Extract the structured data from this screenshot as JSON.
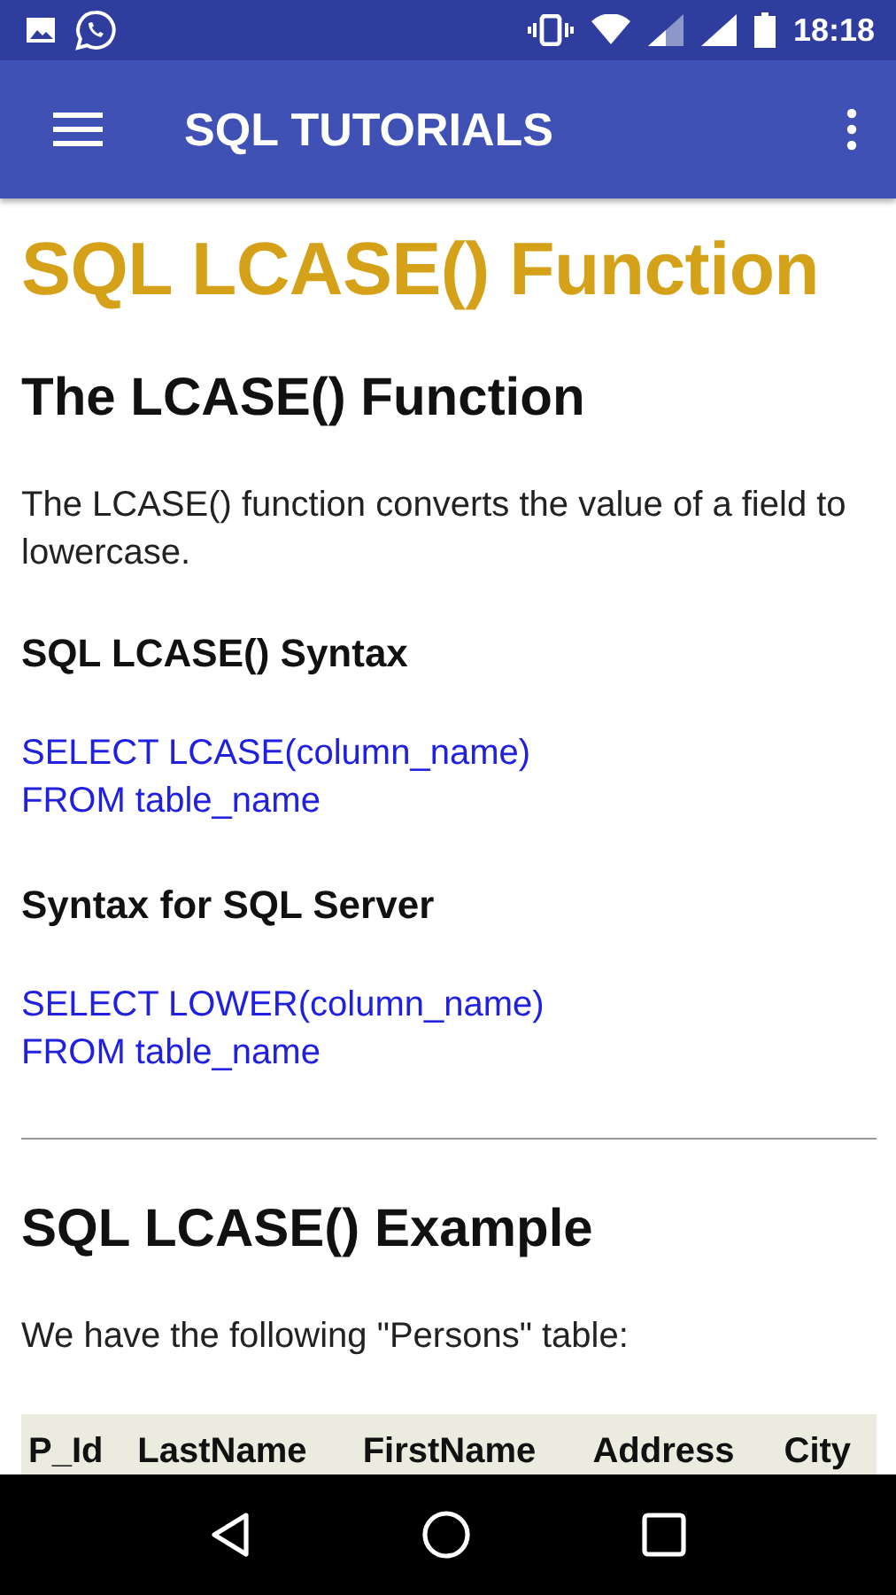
{
  "status_bar": {
    "time": "18:18"
  },
  "app_bar": {
    "title": "SQL TUTORIALS"
  },
  "content": {
    "title": "SQL LCASE() Function",
    "sections": [
      {
        "kind": "h2",
        "text": "The LCASE() Function"
      },
      {
        "kind": "p",
        "text": "The LCASE() function converts the value of a field to lowercase."
      },
      {
        "kind": "h3",
        "text": "SQL LCASE() Syntax"
      },
      {
        "kind": "code",
        "lines": [
          "SELECT LCASE(column_name)",
          "FROM table_name"
        ]
      },
      {
        "kind": "h3",
        "text": "Syntax for SQL Server"
      },
      {
        "kind": "code",
        "lines": [
          "SELECT LOWER(column_name)",
          "FROM table_name"
        ]
      },
      {
        "kind": "hr"
      },
      {
        "kind": "h2",
        "text": "SQL LCASE() Example"
      },
      {
        "kind": "p",
        "text": "We have the following \"Persons\" table:"
      }
    ],
    "table": {
      "columns": [
        "P_Id",
        "LastName",
        "FirstName",
        "Address",
        "City"
      ]
    }
  }
}
